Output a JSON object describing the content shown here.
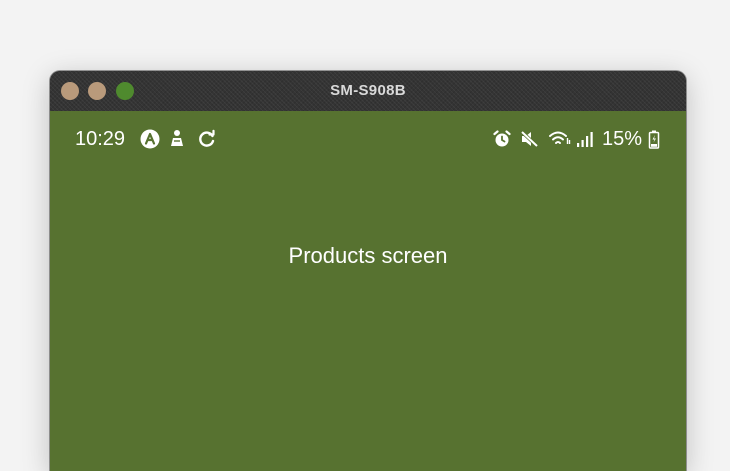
{
  "window": {
    "title": "SM-S908B",
    "traffic_colors": {
      "close": "#b99a7b",
      "minimize": "#b99a7b",
      "zoom": "#4f8a2e"
    }
  },
  "status_bar": {
    "time": "10:29",
    "battery": "15%",
    "left_icons": [
      "app-a-icon",
      "notification-icon",
      "sync-icon"
    ],
    "right_icons": [
      "alarm-icon",
      "mute-icon",
      "wifi-icon",
      "signal-icon",
      "battery-icon"
    ]
  },
  "screen": {
    "text": "Products screen",
    "background": "#577230"
  }
}
